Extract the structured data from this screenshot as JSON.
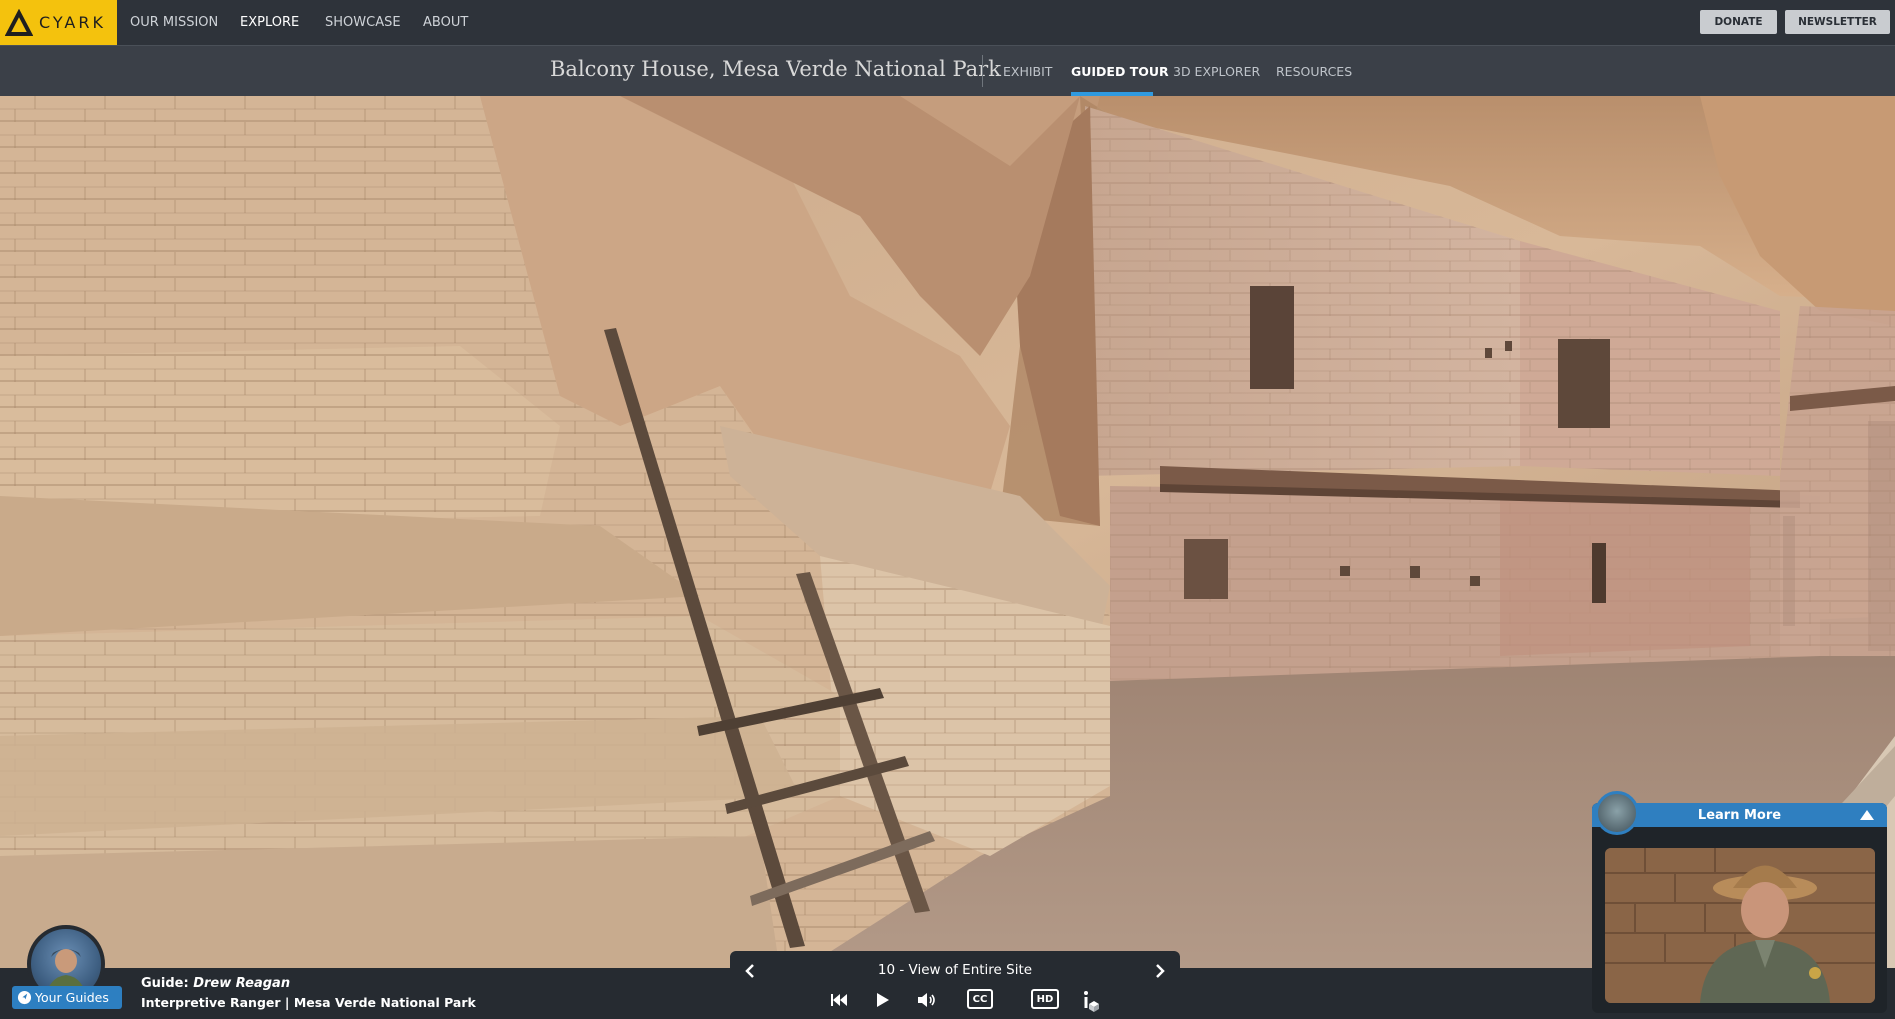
{
  "brand": {
    "name": "CYARK"
  },
  "topnav": {
    "links": [
      "OUR MISSION",
      "EXPLORE",
      "SHOWCASE",
      "ABOUT"
    ],
    "active": "EXPLORE",
    "donate_label": "DONATE",
    "newsletter_label": "NEWSLETTER"
  },
  "subnav": {
    "site_title": "Balcony House, Mesa Verde National Park",
    "tabs": [
      "EXHIBIT",
      "GUIDED TOUR",
      "3D EXPLORER",
      "RESOURCES"
    ],
    "active_tab": "GUIDED TOUR"
  },
  "guide": {
    "your_guides_label": "Your Guides",
    "prefix": "Guide:",
    "name": "Drew Reagan",
    "role": "Interpretive Ranger | Mesa Verde National Park"
  },
  "player": {
    "track_title": "10 - View of Entire Site",
    "controls": [
      "previous-stop",
      "next-stop",
      "skip-back",
      "play",
      "volume",
      "closed-captions",
      "hd",
      "info"
    ],
    "cc_label": "CC",
    "hd_label": "HD"
  },
  "learn_more": {
    "label": "Learn More"
  },
  "colors": {
    "accent_yellow": "#f4c20d",
    "accent_blue": "#2f7fc0",
    "nav_bg": "#2e333a",
    "subnav_bg": "#3b4048"
  }
}
